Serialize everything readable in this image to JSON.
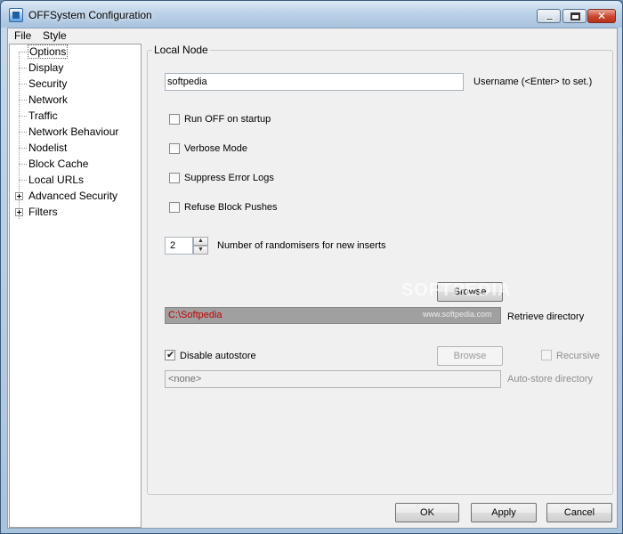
{
  "window": {
    "title": "OFFSystem Configuration",
    "controls": {
      "minimize": "minimize",
      "maximize": "maximize",
      "close": "✕"
    }
  },
  "menu": {
    "file": "File",
    "style": "Style"
  },
  "tree": {
    "items": [
      {
        "label": "Options",
        "selected": true
      },
      {
        "label": "Display"
      },
      {
        "label": "Security"
      },
      {
        "label": "Network"
      },
      {
        "label": "Traffic"
      },
      {
        "label": "Network Behaviour"
      },
      {
        "label": "Nodelist"
      },
      {
        "label": "Block Cache"
      },
      {
        "label": "Local URLs"
      },
      {
        "label": "Advanced Security",
        "expandable": true
      },
      {
        "label": "Filters",
        "expandable": true
      }
    ]
  },
  "local_node": {
    "group_label": "Local Node",
    "username_value": "softpedia",
    "username_label": "Username (<Enter> to set.)",
    "checkboxes": [
      {
        "label": "Run OFF on startup",
        "checked": false
      },
      {
        "label": "Verbose Mode",
        "checked": false
      },
      {
        "label": "Suppress Error Logs",
        "checked": false
      },
      {
        "label": "Refuse Block Pushes",
        "checked": false
      }
    ],
    "randomisers_value": "2",
    "randomisers_label": "Number of randomisers for new inserts",
    "retrieve_browse": "Browse",
    "retrieve_dir_value": "C:\\Softpedia",
    "retrieve_dir_label": "Retrieve directory",
    "disable_autostore_label": "Disable autostore",
    "disable_autostore_checked": true,
    "autostore_browse": "Browse",
    "recursive_label": "Recursive",
    "recursive_checked": false,
    "autostore_dir_value": "<none>",
    "autostore_dir_label": "Auto-store directory"
  },
  "watermark": {
    "text": "SOFTPEDIA",
    "url": "www.softpedia.com"
  },
  "footer": {
    "ok": "OK",
    "apply": "Apply",
    "cancel": "Cancel"
  }
}
